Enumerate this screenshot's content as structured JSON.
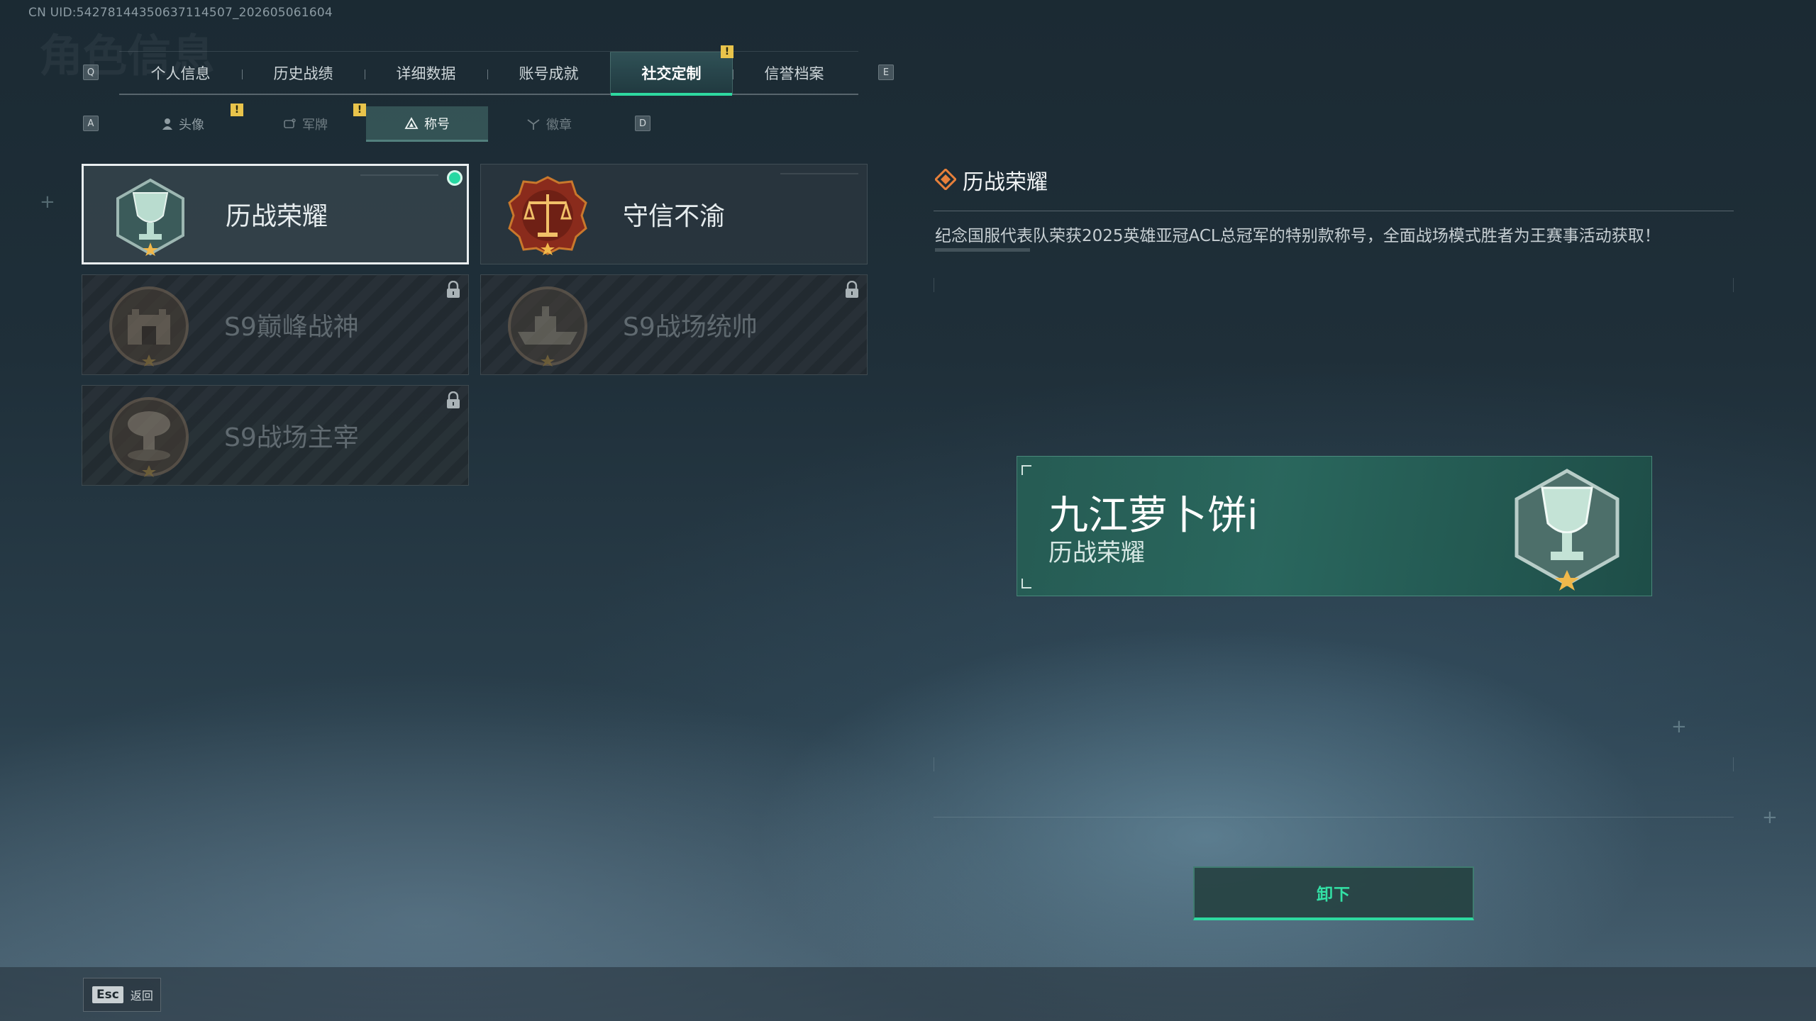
{
  "uid_text": "CN UID:542781443506371145​07_202605061604",
  "ghost_title": "角色信息",
  "hints": {
    "q": "Q",
    "e": "E",
    "a": "A",
    "d": "D"
  },
  "main_tabs": [
    {
      "label": "个人信息",
      "active": false
    },
    {
      "label": "历史战绩",
      "active": false
    },
    {
      "label": "详细数据",
      "active": false
    },
    {
      "label": "账号成就",
      "active": false
    },
    {
      "label": "社交定制",
      "active": true,
      "badge": "!"
    },
    {
      "label": "信誉档案",
      "active": false
    }
  ],
  "sub_tabs": [
    {
      "label": "头像",
      "icon": "person-icon",
      "badge": "!"
    },
    {
      "label": "军牌",
      "icon": "dogtag-icon",
      "badge": "!"
    },
    {
      "label": "称号",
      "icon": "title-icon",
      "active": true
    },
    {
      "label": "徽章",
      "icon": "medal-icon"
    }
  ],
  "titles": [
    {
      "name": "历战荣耀",
      "emblem": "trophy-icon",
      "state": "equipped"
    },
    {
      "name": "守信不渝",
      "emblem": "scales-icon",
      "state": "unlocked"
    },
    {
      "name": "S9巅峰战神",
      "emblem": "fortress-icon",
      "state": "locked"
    },
    {
      "name": "S9战场统帅",
      "emblem": "warship-icon",
      "state": "locked"
    },
    {
      "name": "S9战场主宰",
      "emblem": "mushroom-cloud-icon",
      "state": "locked"
    }
  ],
  "detail": {
    "title": "历战荣耀",
    "description": "纪念国服代表队荣获2025英雄亚冠ACL总冠军的特别款称号，全面战场模式胜者为王赛事活动获取！"
  },
  "preview": {
    "player_name": "九江萝卜饼i",
    "title": "历战荣耀"
  },
  "unequip_label": "卸下",
  "footer": {
    "esc_key": "Esc",
    "back_label": "返回"
  },
  "colors": {
    "accent": "#2ed9a0",
    "warning": "#e9c44b",
    "equipped_dot": "#27d8a2"
  }
}
